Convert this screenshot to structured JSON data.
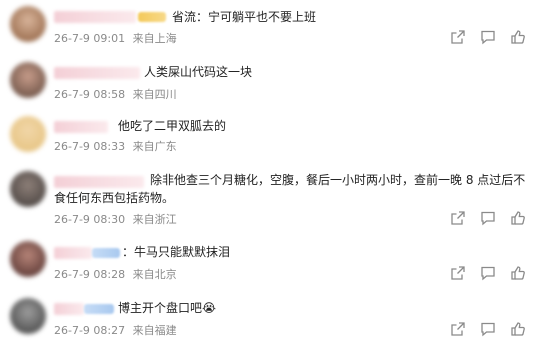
{
  "comments": [
    {
      "text": "省流：宁可躺平也不要上班",
      "timestamp": "26-7-9 09:01",
      "location": "来自上海",
      "avatar_colors": [
        "#8a5a3a",
        "#d8b49a"
      ],
      "badge": "gold"
    },
    {
      "text": "人类屎山代码这一块",
      "timestamp": "26-7-9 08:58",
      "location": "来自四川",
      "avatar_colors": [
        "#5a4338",
        "#c79c8a"
      ],
      "badge": "none"
    },
    {
      "text": "他吃了二甲双胍去的",
      "timestamp": "26-7-9 08:33",
      "location": "来自广东",
      "avatar_colors": [
        "#f1d6a8",
        "#e4c07a"
      ],
      "badge": "none"
    },
    {
      "text": "除非他查三个月糖化，空腹，餐后一小时两小时，查前一晚 8 点过后不食任何东西包括药物。",
      "timestamp": "26-7-9 08:30",
      "location": "来自浙江",
      "avatar_colors": [
        "#3f3a38",
        "#8d7f78"
      ],
      "badge": "none"
    },
    {
      "text": "：牛马只能默默抹泪",
      "timestamp": "26-7-9 08:28",
      "location": "来自北京",
      "avatar_colors": [
        "#4a2a28",
        "#b68478"
      ],
      "badge": "blue"
    },
    {
      "text": "博主开个盘口吧😭",
      "timestamp": "26-7-9 08:27",
      "location": "来自福建",
      "avatar_colors": [
        "#3a3a3a",
        "#9c9c9c"
      ],
      "badge": "blue"
    }
  ],
  "icons": [
    "share-icon",
    "comment-icon",
    "like-icon"
  ],
  "colors": {
    "meta_text": "#8a8a8a",
    "icon": "#8a8a8a",
    "body_text": "#222222"
  }
}
